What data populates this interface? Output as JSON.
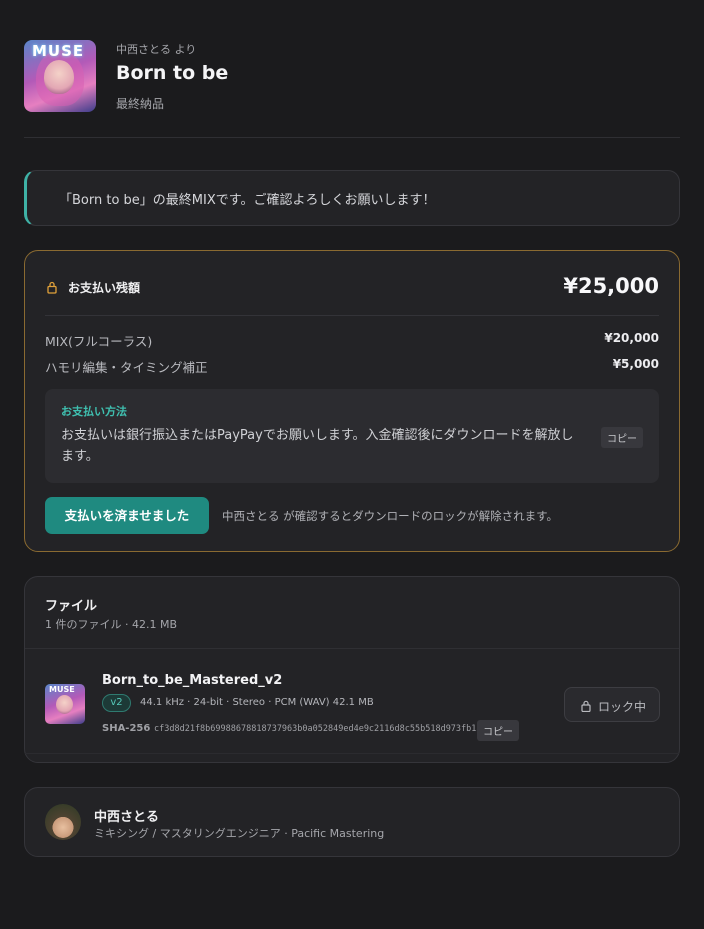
{
  "header": {
    "cover_text": "MUSE",
    "from": "中西さとる より",
    "title": "Born to be",
    "subtitle": "最終納品"
  },
  "message": "「Born to be」の最終MIXです。ご確認よろしくお願いします！",
  "payment": {
    "label": "お支払い残額",
    "total": "¥25,000",
    "items": [
      {
        "name": "MIX(フルコーラス)",
        "amount": "¥20,000"
      },
      {
        "name": "ハモリ編集・タイミング補正",
        "amount": "¥5,000"
      }
    ],
    "method_label": "お支払い方法",
    "method_text": "お支払いは銀行振込またはPayPayでお願いします。入金確認後にダウンロードを解放します。",
    "copy_label": "コピー",
    "paid_button": "支払いを済ませました",
    "note": "中西さとる が確認するとダウンロードのロックが解除されます。",
    "accent_color": "#1f8a80",
    "border_color": "#8a6a31"
  },
  "files": {
    "title": "ファイル",
    "meta": "1 件のファイル · 42.1 MB",
    "items": [
      {
        "thumb_text": "MUSE",
        "name": "Born_to_be_Mastered_v2",
        "version": "v2",
        "specs": "44.1 kHz · 24-bit · Stereo · PCM (WAV)   42.1 MB",
        "sha_label": "SHA-256",
        "sha": "cf3d8d21f8b69988678818737963b0a052849ed4e9c2116d8c55b518d973fb13",
        "copy_label": "コピー",
        "lock_label": "ロック中"
      }
    ]
  },
  "profile": {
    "name": "中西さとる",
    "role": "ミキシング / マスタリングエンジニア · Pacific Mastering"
  }
}
